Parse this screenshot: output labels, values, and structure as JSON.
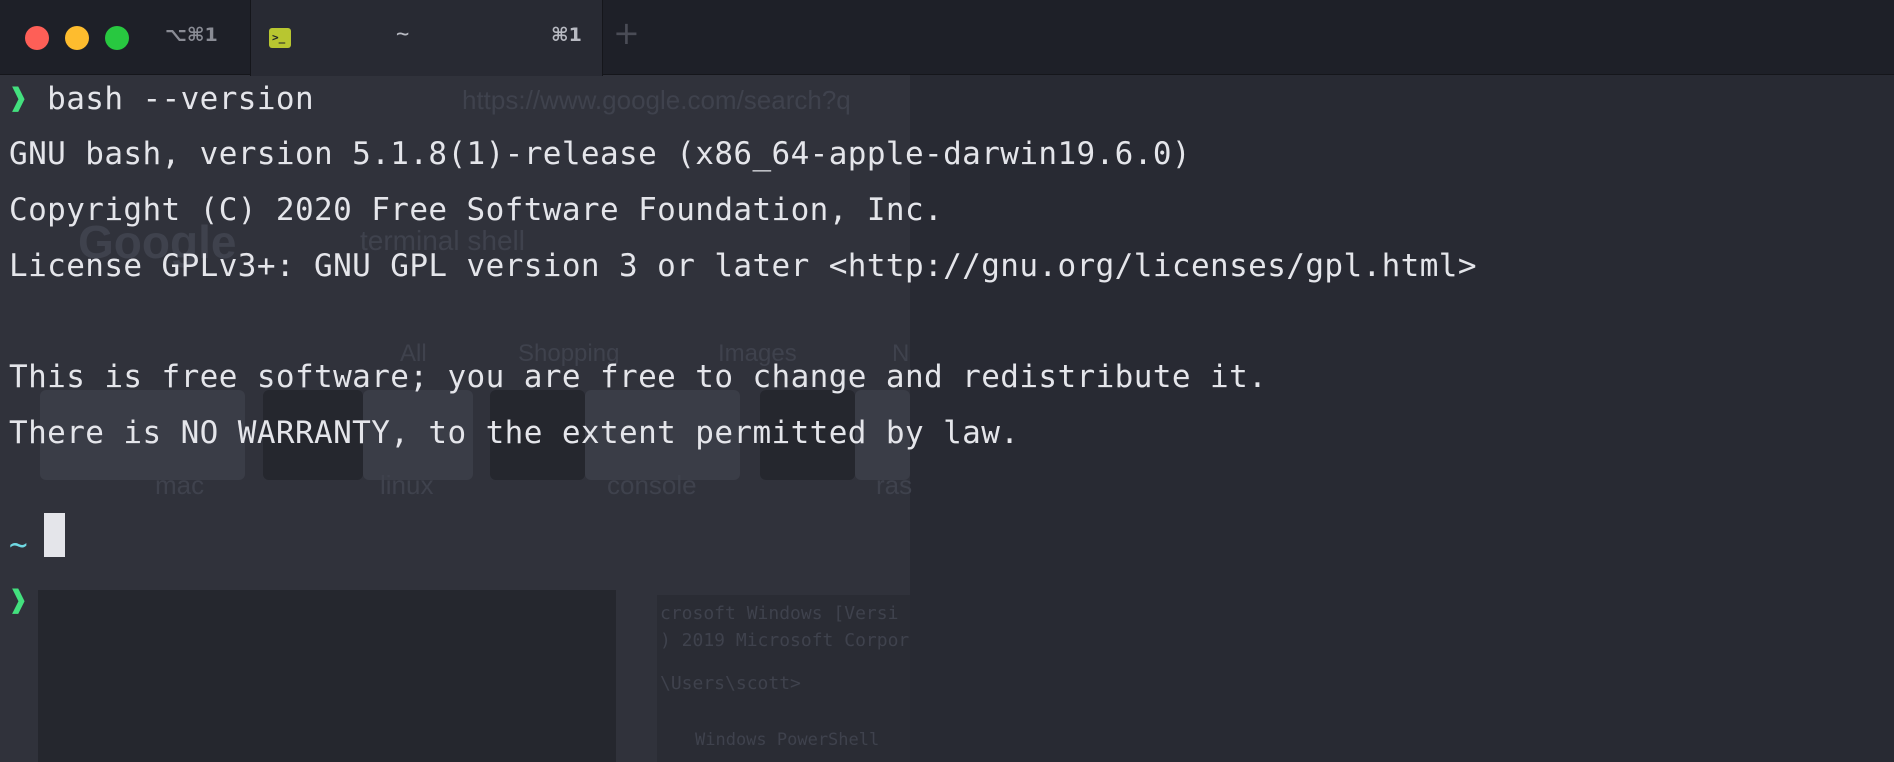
{
  "titlebar": {
    "window_shortcut": "⌥⌘1",
    "tab": {
      "icon_label": ">_",
      "title": "~",
      "shortcut": "⌘1"
    },
    "new_tab": "+"
  },
  "terminal": {
    "prompt_symbol": "❱",
    "command": "bash --version",
    "output": [
      "GNU bash, version 5.1.8(1)-release (x86_64-apple-darwin19.6.0)",
      "Copyright (C) 2020 Free Software Foundation, Inc.",
      "License GPLv3+: GNU GPL version 3 or later <http://gnu.org/licenses/gpl.html>",
      "",
      "This is free software; you are free to change and redistribute it.",
      "There is NO WARRANTY, to the extent permitted by law."
    ],
    "cwd": "~"
  },
  "background": {
    "url": "https://www.google.com/search?q",
    "logo": "Google",
    "query": "terminal shell",
    "filters": [
      "All",
      "Shopping",
      "Images",
      "N"
    ],
    "chips": [
      "mac",
      "linux",
      "console",
      "ras"
    ],
    "image_text_1": "crosoft Windows [Versi",
    "image_text_2": ") 2019 Microsoft Corpor",
    "image_text_3": "\\Users\\scott>",
    "image_text_4": "Windows PowerShell"
  },
  "colors": {
    "prompt": "#43e07e",
    "tilde": "#6fd8e2",
    "text": "#e4e5ea",
    "background": "#282a33",
    "tab_icon": "#b8c630"
  }
}
